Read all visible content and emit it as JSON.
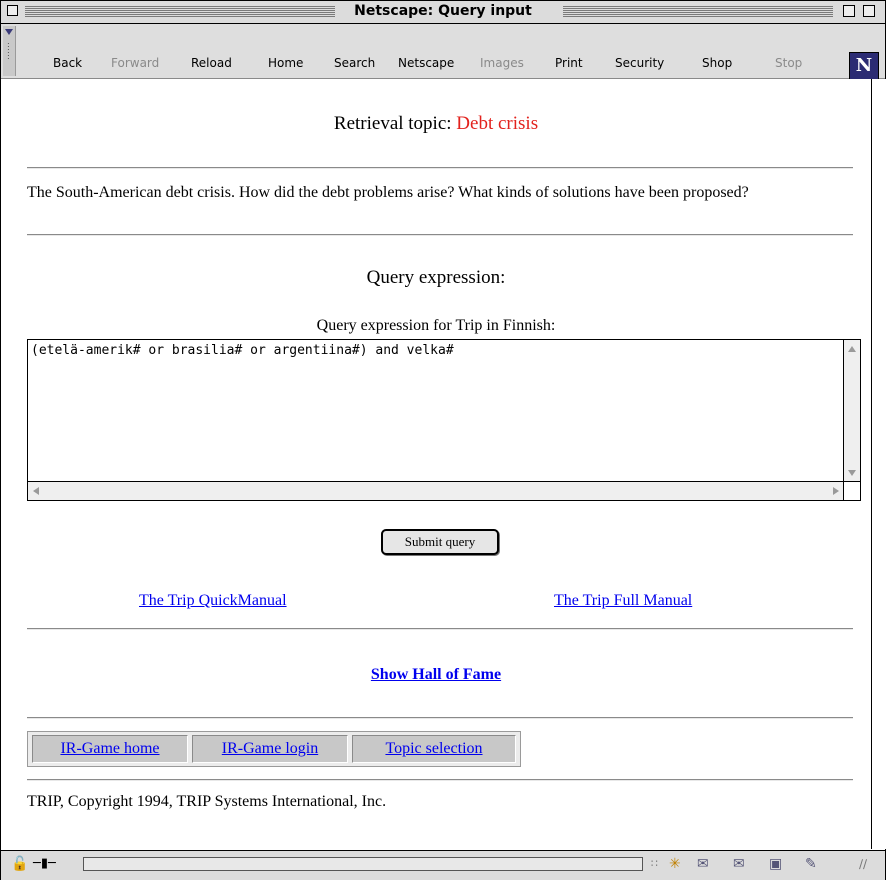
{
  "window": {
    "title": "Netscape: Query input"
  },
  "toolbar": {
    "buttons": [
      {
        "label": "Back",
        "enabled": true
      },
      {
        "label": "Forward",
        "enabled": false
      },
      {
        "label": "Reload",
        "enabled": true
      },
      {
        "label": "Home",
        "enabled": true
      },
      {
        "label": "Search",
        "enabled": true
      },
      {
        "label": "Netscape",
        "enabled": true
      },
      {
        "label": "Images",
        "enabled": false
      },
      {
        "label": "Print",
        "enabled": true
      },
      {
        "label": "Security",
        "enabled": true
      },
      {
        "label": "Shop",
        "enabled": true
      },
      {
        "label": "Stop",
        "enabled": false
      }
    ],
    "logo": "N",
    "location_tab": "▸ …… ∕ ▸ …… ∕"
  },
  "page": {
    "topic_label": "Retrieval topic:",
    "topic_value": "Debt crisis",
    "topic_color": "#e2221d",
    "description": "The South-American debt crisis. How did the debt problems arise? What kinds of solutions have been proposed?",
    "query_heading": "Query expression:",
    "query_label": "Query expression for Trip in Finnish:",
    "query_value": "(etelä-amerik# or brasilia# or argentiina#) and velka#",
    "submit_label": "Submit query",
    "quickmanual_link": "The Trip QuickManual",
    "fullmanual_link": "The Trip Full Manual",
    "hall_of_fame_link": "Show Hall of Fame",
    "nav": [
      {
        "label": "IR-Game home"
      },
      {
        "label": "IR-Game login"
      },
      {
        "label": "Topic selection"
      }
    ],
    "copyright": "TRIP, Copyright 1994, TRIP Systems International, Inc."
  },
  "colors": {
    "link": "#0000ee",
    "topic": "#e2221d"
  }
}
